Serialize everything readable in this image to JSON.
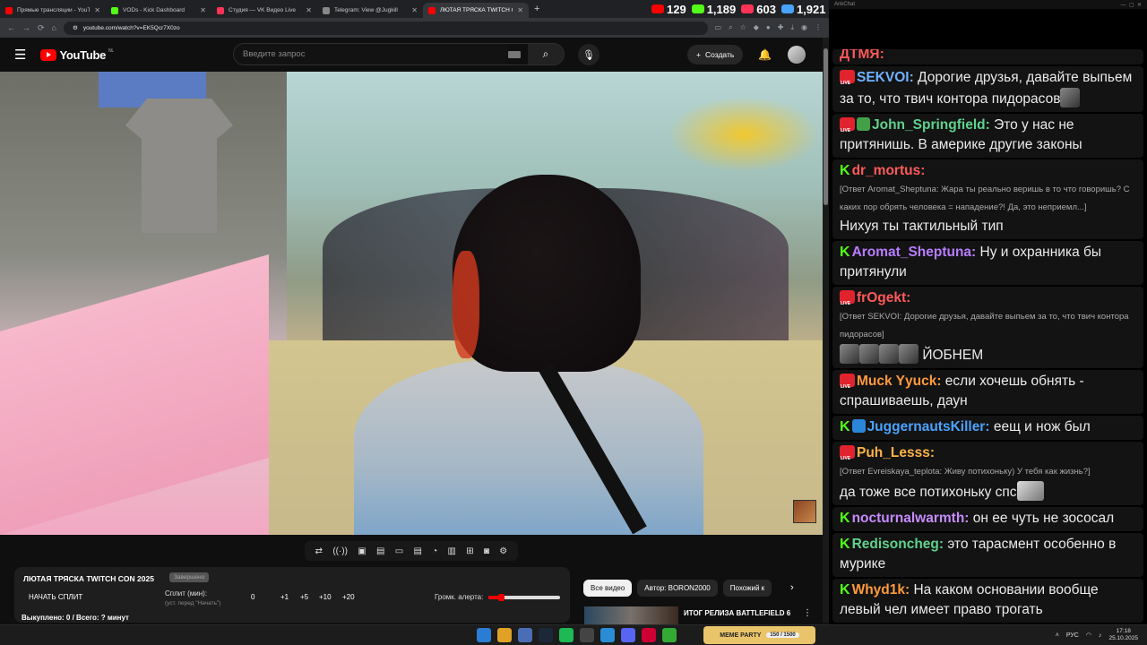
{
  "browser": {
    "tabs": [
      {
        "label": "Прямые трансляции - YouTube",
        "color": "#ff0000"
      },
      {
        "label": "VODs - Kick Dashboard",
        "color": "#53fc18"
      },
      {
        "label": "Студия — VK Видео Live",
        "color": "#ff3355"
      },
      {
        "label": "Telegram: View @Jugkill",
        "color": "#888888"
      },
      {
        "label": "ЛЮТАЯ ТРЯСКА TWITCH CON",
        "color": "#ff0000"
      }
    ],
    "url": "youtube.com/watch?v=EK5Qcr7X0zo"
  },
  "viewer_counters": [
    {
      "platform": "youtube-icon",
      "value": "129",
      "color": "#ff0000"
    },
    {
      "platform": "kick-icon",
      "value": "1,189",
      "color": "#53fc18"
    },
    {
      "platform": "vk-live-icon",
      "value": "603",
      "color": "#ff3355"
    },
    {
      "platform": "total-viewers-icon",
      "value": "1,921",
      "color": "#4aa3ff"
    }
  ],
  "youtube": {
    "logo": "YouTube",
    "region": "NL",
    "search_placeholder": "Введите запрос",
    "create_label": "Создать"
  },
  "panel": {
    "title": "ЛЮТАЯ ТРЯСКА TWITCH CON 2025",
    "tag": "Завершено",
    "split_button": "НАЧАТЬ СПЛИТ",
    "split_label": "Сплит (мин):",
    "split_hint": "(уст. перед \"Начать\")",
    "split_value": "0",
    "increments": [
      "+1",
      "+5",
      "+10",
      "+20"
    ],
    "alert_label": "Громк. алерта:",
    "alert_volume": 0.18,
    "bought": "Выкуплено: 0 / Всего: ? минут"
  },
  "related": {
    "chips": [
      "Все видео",
      "Автор: BORON2000",
      "Похожий к"
    ],
    "first_title": "ИТОГ РЕЛИЗА BATTLEFIELD 6"
  },
  "chat": {
    "app_title": "AnkChat",
    "messages": [
      {
        "badges": [
          "kick"
        ],
        "user": "dr_mortus:",
        "color": "#ff5a5a",
        "reply": "[Ответ Aromat_Sheptuna: Жара ты реально веришь в то что говоришь? С каких пор обрять человека = нападение?! Да, это неприемл...]",
        "text": "Нихуя ты тактильный тип"
      },
      {
        "badges": [
          "kick"
        ],
        "user": "Aromat_Sheptuna:",
        "color": "#b87dff",
        "reply": "",
        "text": "Ну и охранника бы притянули"
      },
      {
        "badges": [
          "live"
        ],
        "user": "frOgekt:",
        "color": "#ff5a5a",
        "reply": "[Ответ SEKVOI: Дорогие друзья, давайте выпьем за то, что твич контора пидорасов]",
        "text": "ЙОБНЕМ"
      },
      {
        "badges": [
          "live"
        ],
        "user": "Muck Yyuck:",
        "color": "#ff9a3c",
        "reply": "",
        "text": "если хочешь обнять - спрашиваешь, даун"
      },
      {
        "badges": [
          "kick",
          "sword"
        ],
        "user": "JuggernautsKiller:",
        "color": "#4aa3ff",
        "reply": "",
        "text": "еещ и нож был"
      },
      {
        "badges": [
          "live"
        ],
        "user": "Puh_Lesss:",
        "color": "#ffb347",
        "reply": "[Ответ Evreiskaya_teplota: Живу потихоньку) У тебя как жизнь?]",
        "text": "да тоже все потихоньку спс"
      },
      {
        "badges": [
          "kick"
        ],
        "user": "nocturnalwarmth:",
        "color": "#c58bff",
        "reply": "",
        "text": "он ее чуть не зососал"
      },
      {
        "badges": [
          "kick"
        ],
        "user": "Redisoncheg:",
        "color": "#5fd38d",
        "reply": "",
        "text": "это тарасмент особенно в мурике"
      },
      {
        "badges": [
          "kick"
        ],
        "user": "Whyd1k:",
        "color": "#ff9a3c",
        "reply": "",
        "text": "На каком основании вообще левый чел имеет право трогать"
      }
    ],
    "top_messages": [
      {
        "badges": [
          "live"
        ],
        "user": "SEKVOI:",
        "color": "#6fb3ff",
        "text": "Дорогие друзья, давайте выпьем за то, что твич контора пидорасов"
      },
      {
        "badges": [
          "live",
          "pen"
        ],
        "user": "John_Springfield:",
        "color": "#5fd38d",
        "text": "Это у нас не притянишь. В америке другие законы"
      }
    ],
    "partial_top": "ДТМЯ:"
  },
  "taskbar": {
    "sticker_title": "МЕМЕ PARTY",
    "sticker_progress": "150 / 1500",
    "lang": "РУС",
    "time": "17:18",
    "date": "25.10.2025"
  }
}
